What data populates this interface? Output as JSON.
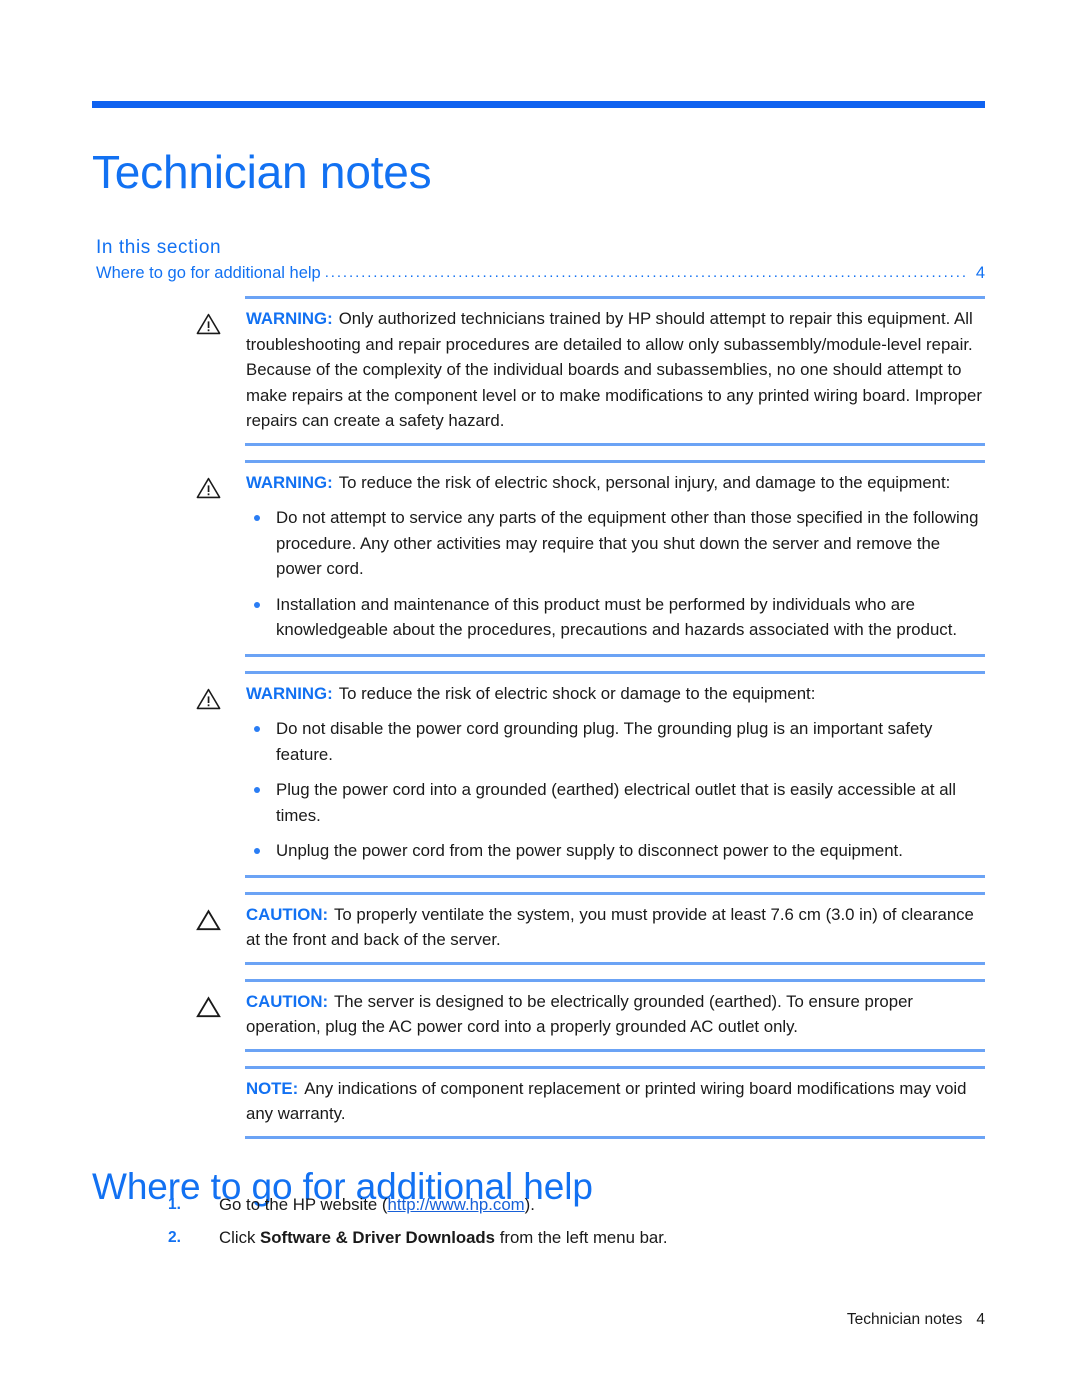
{
  "document": {
    "title": "Technician notes",
    "accent_blue": "#1271f2",
    "rule_blue": "#6ba3f5",
    "header_rule_blue": "#0f62f0"
  },
  "in_this_section": {
    "heading": "In this section",
    "entries": [
      {
        "text": "Where to go for additional help",
        "leader": "..........................................................................................................",
        "page": "4"
      }
    ]
  },
  "alerts": [
    {
      "id": "warning-authorized-technicians",
      "icon": "warning-triangle-icon",
      "label": "WARNING:",
      "text": "Only authorized technicians trained by HP should attempt to repair this equipment. All troubleshooting and repair procedures are detailed to allow only subassembly/module-level repair. Because of the complexity of the individual boards and subassemblies, no one should attempt to make repairs at the component level or to make modifications to any printed wiring board. Improper repairs can create a safety hazard.",
      "bullets": []
    },
    {
      "id": "warning-electric-shock-injury",
      "icon": "warning-triangle-icon",
      "label": "WARNING:",
      "text": "To reduce the risk of electric shock, personal injury, and damage to the equipment:",
      "bullets": [
        "Do not attempt to service any parts of the equipment other than those specified in the following procedure. Any other activities may require that you shut down the server and remove the power cord.",
        "Installation and maintenance of this product must be performed by individuals who are knowledgeable about the procedures, precautions and hazards associated with the product."
      ]
    },
    {
      "id": "warning-electric-shock-damage",
      "icon": "warning-triangle-icon",
      "label": "WARNING:",
      "text": "To reduce the risk of electric shock or damage to the equipment:",
      "bullets": [
        "Do not disable the power cord grounding plug. The grounding plug is an important safety feature.",
        "Plug the power cord into a grounded (earthed) electrical outlet that is easily accessible at all times.",
        "Unplug the power cord from the power supply to disconnect power to the equipment."
      ]
    },
    {
      "id": "caution-ventilation",
      "icon": "caution-triangle-icon",
      "label": "CAUTION:",
      "text": "To properly ventilate the system, you must provide at least 7.6 cm (3.0 in) of clearance at the front and back of the server.",
      "bullets": []
    },
    {
      "id": "caution-grounding",
      "icon": "caution-triangle-icon",
      "label": "CAUTION:",
      "text": "The server is designed to be electrically grounded (earthed). To ensure proper operation, plug the AC power cord into a properly grounded AC outlet only.",
      "bullets": []
    },
    {
      "id": "note-warranty",
      "icon": "none",
      "label": "NOTE:",
      "text": "Any indications of component replacement or printed wiring board modifications may void any warranty.",
      "bullets": []
    }
  ],
  "help_section": {
    "heading": "Where to go for additional help",
    "steps": [
      {
        "number": "1.",
        "prefix": "Go to the HP website (",
        "link": "http://www.hp.com",
        "suffix": ")."
      },
      {
        "number": "2.",
        "prefix": "Click ",
        "bold": "Software & Driver Downloads",
        "suffix": " from the left menu bar."
      }
    ]
  },
  "footer": {
    "chapter": "Technician notes",
    "page": "4"
  }
}
